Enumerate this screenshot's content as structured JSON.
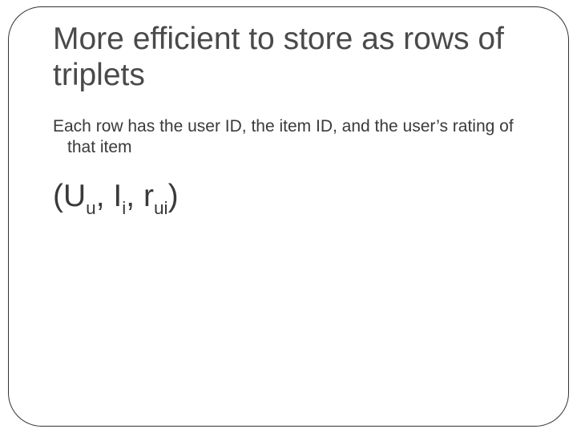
{
  "title": "More efficient to store as rows of triplets",
  "body": "Each row has the user ID, the item ID, and the user’s rating of that item",
  "formula": {
    "open": "(",
    "t1_base": "U",
    "t1_sub": "u",
    "sep1": ", ",
    "t2_base": "I",
    "t2_sub": "i",
    "sep2": ", ",
    "t3_base": "r",
    "t3_sub": "ui",
    "close": ")"
  }
}
